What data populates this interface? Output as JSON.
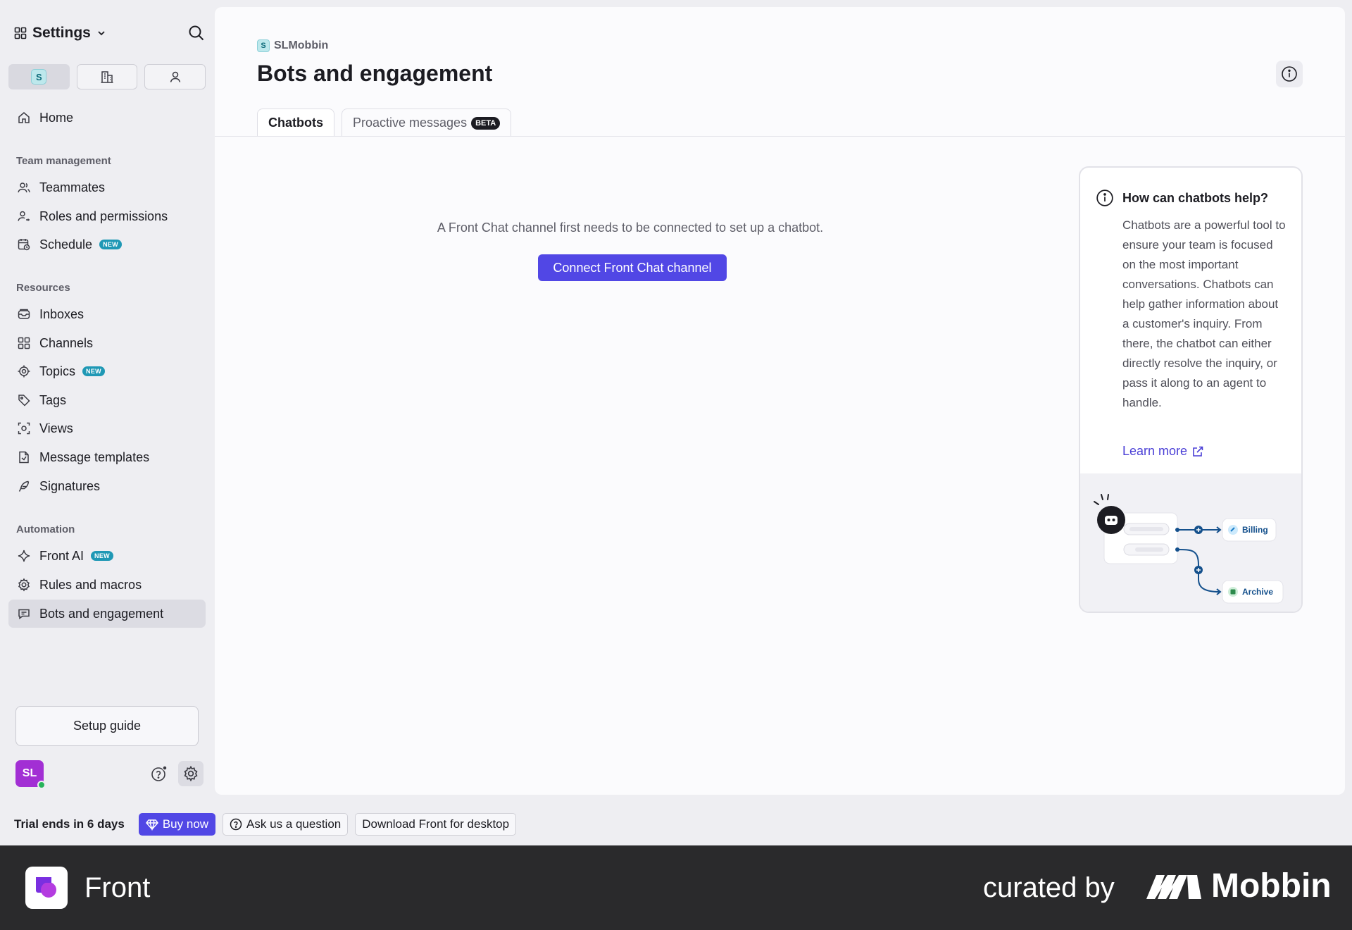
{
  "sidebar": {
    "title": "Settings",
    "scope_chip": "S",
    "home": "Home",
    "sections": {
      "team": "Team management",
      "resources": "Resources",
      "automation": "Automation"
    },
    "team_items": {
      "teammates": "Teammates",
      "roles": "Roles and permissions",
      "schedule": "Schedule",
      "schedule_badge": "NEW"
    },
    "resource_items": {
      "inboxes": "Inboxes",
      "channels": "Channels",
      "topics": "Topics",
      "topics_badge": "NEW",
      "tags": "Tags",
      "views": "Views",
      "templates": "Message templates",
      "signatures": "Signatures"
    },
    "automation_items": {
      "front_ai": "Front AI",
      "front_ai_badge": "NEW",
      "rules": "Rules and macros",
      "bots": "Bots and engagement"
    },
    "setup_guide": "Setup guide",
    "avatar_initials": "SL"
  },
  "main": {
    "breadcrumb_chip": "S",
    "breadcrumb": "SLMobbin",
    "title": "Bots and engagement",
    "tabs": {
      "chatbots": "Chatbots",
      "proactive": "Proactive messages",
      "proactive_badge": "BETA"
    },
    "empty_state": "A Front Chat channel first needs to be connected to set up a chatbot.",
    "connect_button": "Connect Front Chat channel",
    "help": {
      "title": "How can chatbots help?",
      "body": "Chatbots are a powerful tool to ensure your team is focused on the most important conversations. Chatbots can help gather information about a customer's inquiry. From there, the chatbot can either directly resolve the inquiry, or pass it along to an agent to handle.",
      "learn_more": "Learn more",
      "illus_billing": "Billing",
      "illus_archive": "Archive"
    }
  },
  "trial_bar": {
    "trial_text": "Trial ends in 6 days",
    "buy": "Buy now",
    "ask": "Ask us a question",
    "download": "Download Front for desktop"
  },
  "footer": {
    "app_name": "Front",
    "curated": "curated by",
    "brand": "Mobbin"
  },
  "colors": {
    "accent": "#5147e5",
    "new_badge": "#1f98b5",
    "avatar": "#a22fd4",
    "footer_bg": "#2a2a2c"
  }
}
